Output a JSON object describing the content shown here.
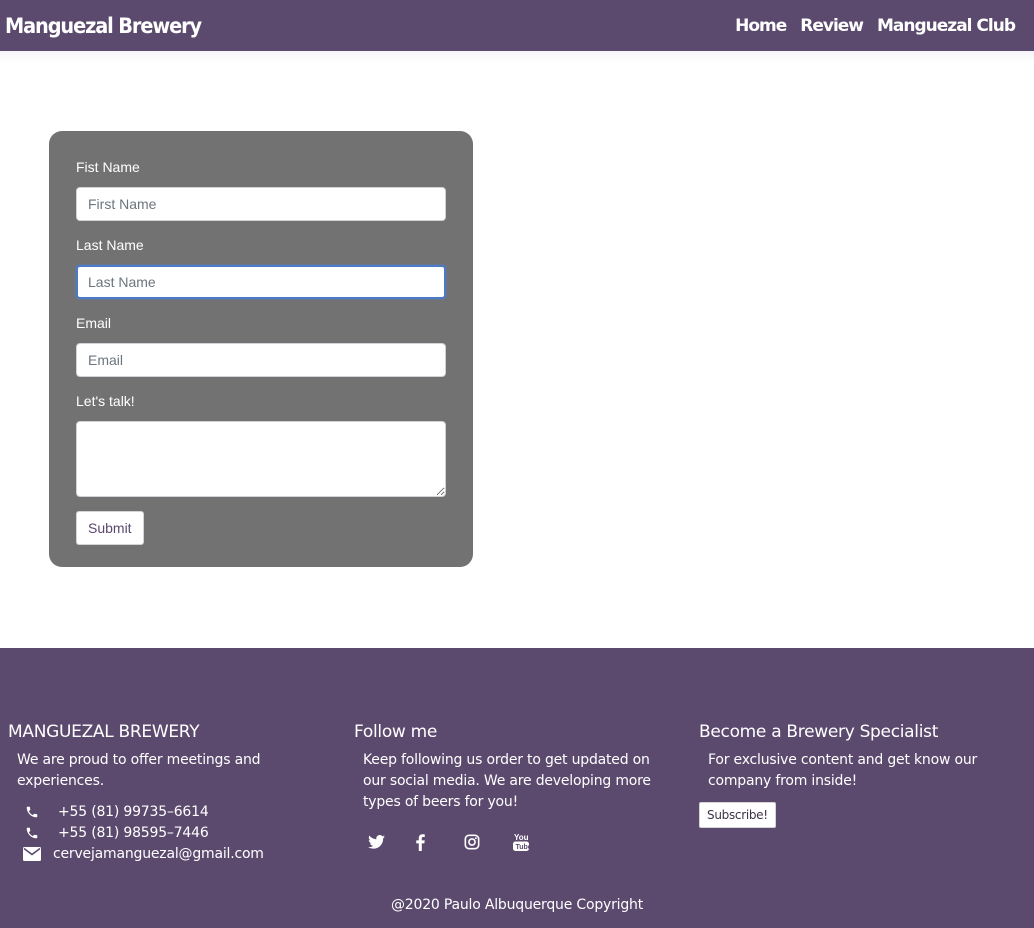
{
  "navbar": {
    "brand": "Manguezal Brewery",
    "links": [
      "Home",
      "Review",
      "Manguezal Club"
    ]
  },
  "form": {
    "first_name_label": "Fist Name",
    "first_name_placeholder": "First Name",
    "last_name_label": "Last Name",
    "last_name_placeholder": "Last Name",
    "email_label": "Email",
    "email_placeholder": "Email",
    "message_label": "Let's talk!",
    "submit_label": "Submit"
  },
  "footer": {
    "about": {
      "title": "MANGUEZAL BREWERY",
      "text": "We are proud to offer meetings and experiences.",
      "phone1": "+55 (81) 99735–6614",
      "phone2": "+55 (81) 98595–7446",
      "email": "cervejamanguezal@gmail.com"
    },
    "follow": {
      "title": "Follow me",
      "text": "Keep following us order to get updated on our social media. We are developing more types of beers for you!",
      "icons": [
        "twitter-icon",
        "facebook-icon",
        "instagram-icon",
        "youtube-icon"
      ]
    },
    "specialist": {
      "title": "Become a Brewery Specialist",
      "text": "For exclusive content and get know our company from inside!",
      "button_label": "Subscribe!"
    },
    "copyright": "@2020 Paulo Albuquerque Copyright"
  },
  "colors": {
    "brand_purple": "#5b4a6e",
    "form_gray": "#727272"
  }
}
